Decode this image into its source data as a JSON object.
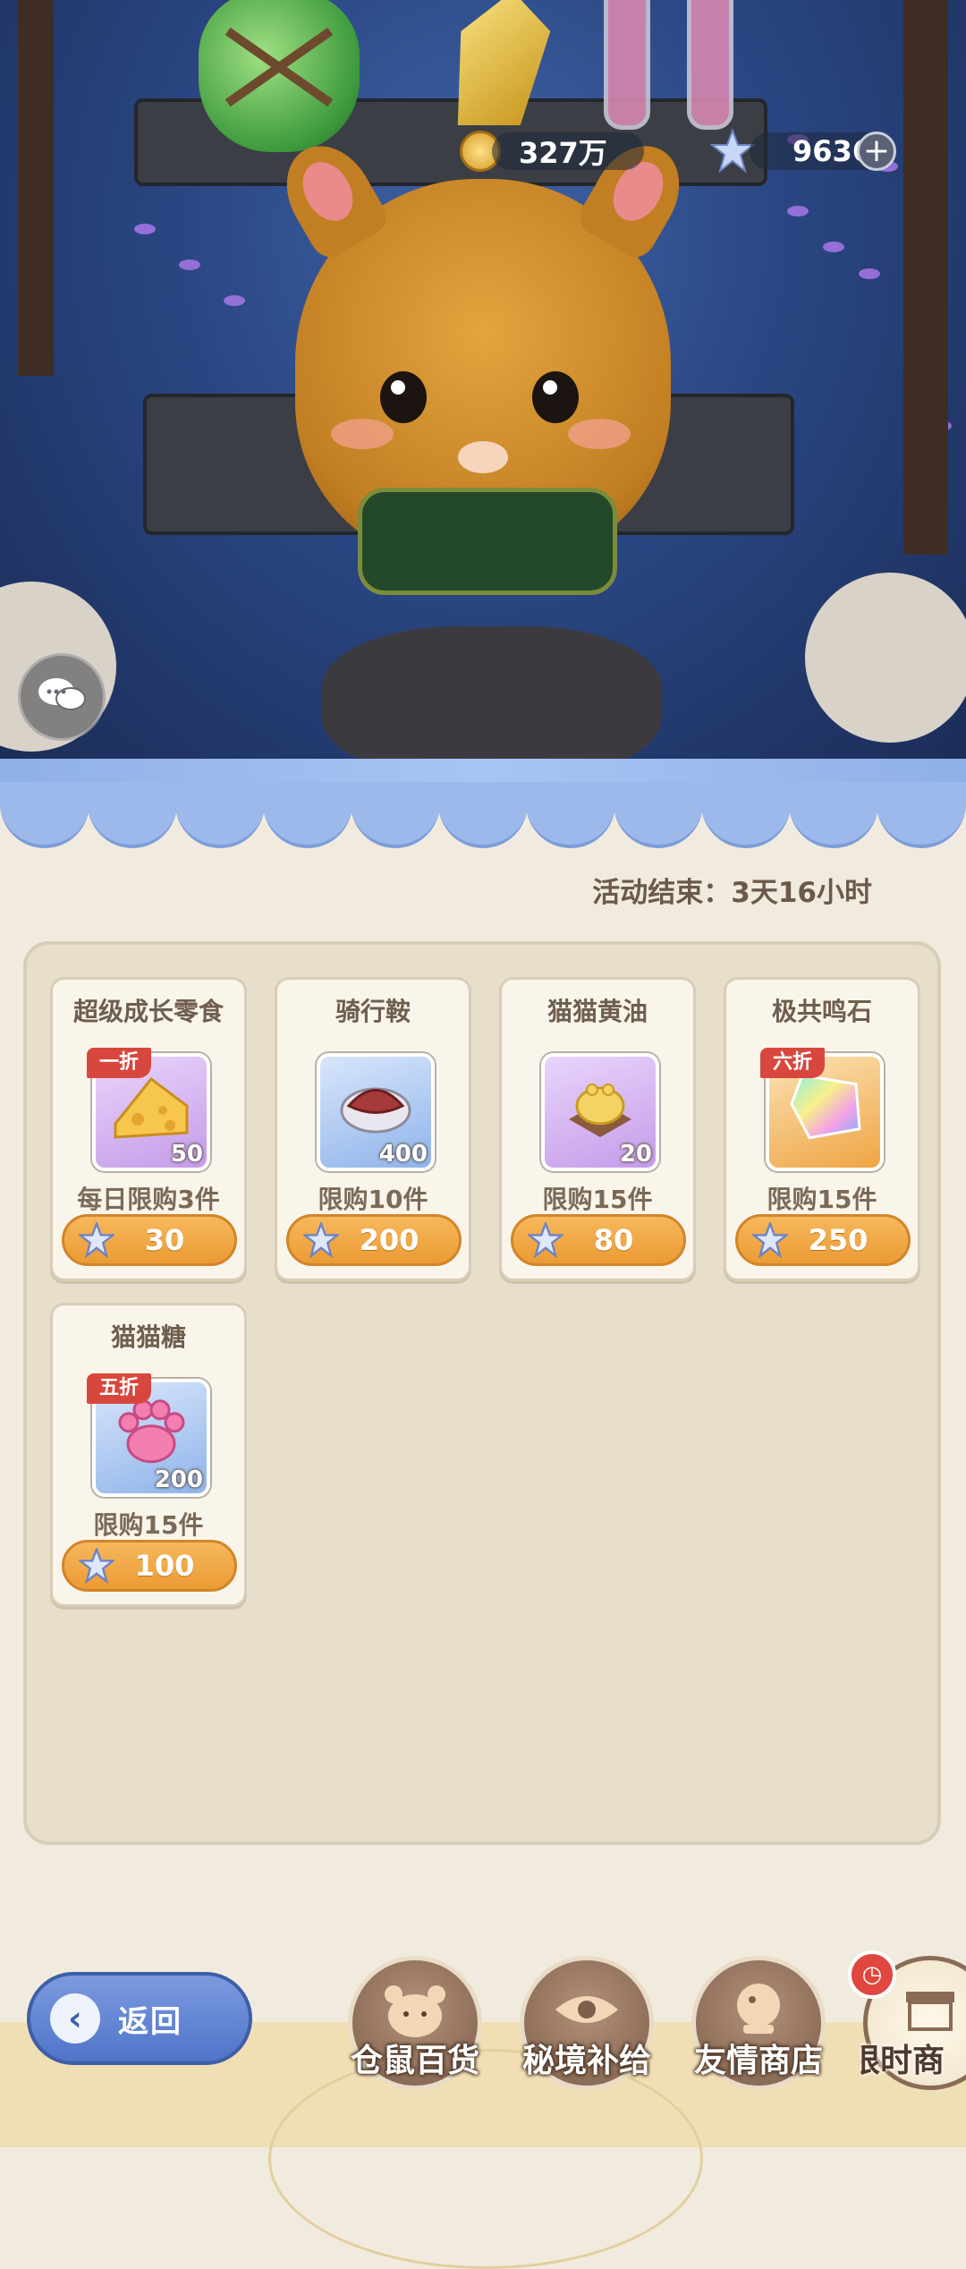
{
  "currency": {
    "coins": "327万",
    "stars": "9636",
    "plus_symbol": "+"
  },
  "shop": {
    "timer_text": "活动结束：3天16小时",
    "items": [
      {
        "name": "超级成长零食",
        "discount": "一折",
        "quantity": "50",
        "limit": "每日限购3件",
        "price": "30",
        "icon": "cheese-icon",
        "frame": "purple"
      },
      {
        "name": "骑行鞍",
        "discount": "",
        "quantity": "400",
        "limit": "限购10件",
        "price": "200",
        "icon": "saddle-icon",
        "frame": "blue"
      },
      {
        "name": "猫猫黄油",
        "discount": "",
        "quantity": "20",
        "limit": "限购15件",
        "price": "80",
        "icon": "butter-icon",
        "frame": "purple"
      },
      {
        "name": "极共鸣石",
        "discount": "六折",
        "quantity": "",
        "limit": "限购15件",
        "price": "250",
        "icon": "resonance-stone-icon",
        "frame": "orange"
      },
      {
        "name": "猫猫糖",
        "discount": "五折",
        "quantity": "200",
        "limit": "限购15件",
        "price": "100",
        "icon": "paw-candy-icon",
        "frame": "blue"
      }
    ]
  },
  "navigation": {
    "back_label": "返回",
    "tabs": [
      {
        "label": "仓鼠百货",
        "icon": "hamster-icon",
        "active": false
      },
      {
        "label": "秘境补给",
        "icon": "eye-emblem-icon",
        "active": false
      },
      {
        "label": "友情商店",
        "icon": "crystal-ball-icon",
        "active": false
      },
      {
        "label": "限时商",
        "icon": "shop-stall-icon",
        "active": true
      }
    ],
    "notification_symbol": "◷"
  },
  "colors": {
    "price_button": "#eb9b34",
    "awning": "#9db9ec",
    "discount_badge": "#d8473d",
    "back_button": "#5074c8"
  }
}
